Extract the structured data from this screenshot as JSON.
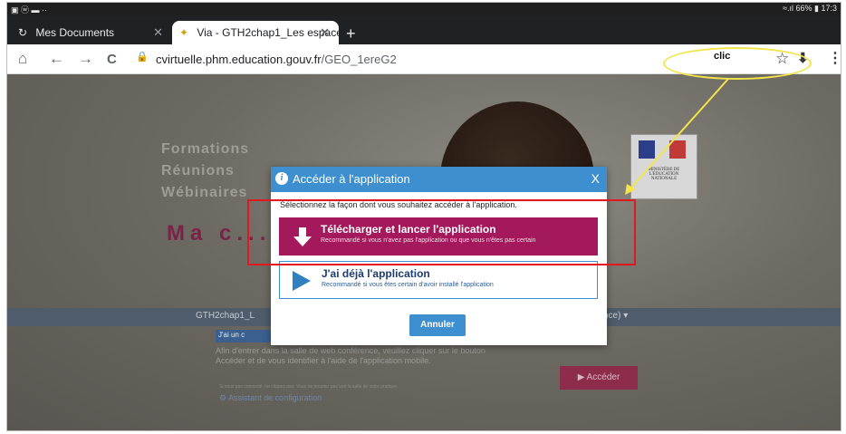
{
  "statusbar": {
    "left": "▣ ⓦ ▬ ··",
    "right": "≈.ıl 66% ▮ 17:3"
  },
  "tabs": [
    {
      "label": "Mes Documents",
      "close": "✕"
    },
    {
      "label": "Via - GTH2chap1_Les espace",
      "close": "✕"
    }
  ],
  "new_tab": "+",
  "toolbar": {
    "home": "⌂",
    "back": "←",
    "forward": "→",
    "reload": "C",
    "url_host": "cvirtuelle.phm.education.gouv.fr",
    "url_path": "/GEO_1ereG2",
    "lock_icon": "🔒",
    "star": "☆",
    "download": "⬇",
    "menu": "⋮"
  },
  "annotation": {
    "clic_label": "clic"
  },
  "background_page": {
    "hero_lines": [
      "Formations",
      "Réunions",
      "Wébinaires"
    ],
    "brand": "Ma c... e",
    "flag_text": "MINISTÈRE DE L'ÉDUCATION NATIONALE",
    "band_left": "GTH2chap1_L",
    "band_right": "nce) ▾",
    "jai_btn": "J'ai un c",
    "info_lines": [
      "Afin d'entrer dans la salle de web conférence, veuillez cliquer sur le bouton",
      "Accéder et de vous identifier à l'aide de l'application mobile."
    ],
    "small_note": "Si vous pas connecté, ne cliquez pas. Vous ne pourrez pas voir la salle de votre pratique.",
    "assistant": "⚙ Assistant de configuration",
    "acceder": "▶  Accéder"
  },
  "modal": {
    "title": "Accéder à l'application",
    "close": "X",
    "prompt": "Sélectionnez la façon dont vous souhaitez accéder à l'application.",
    "option1": {
      "title": "Télécharger et lancer l'application",
      "subtitle": "Recommandé si vous n'avez pas l'application ou que vous n'êtes pas certain"
    },
    "option2": {
      "title": "J'ai déjà l'application",
      "subtitle": "Recommandé si vous êtes certain d'avoir installé l'application"
    },
    "cancel": "Annuler"
  },
  "colors": {
    "modal_header": "#3d8fcf",
    "option1_bg": "#a4185c",
    "highlight_red": "#e3171e",
    "annotation_yellow": "#f2e44a"
  }
}
